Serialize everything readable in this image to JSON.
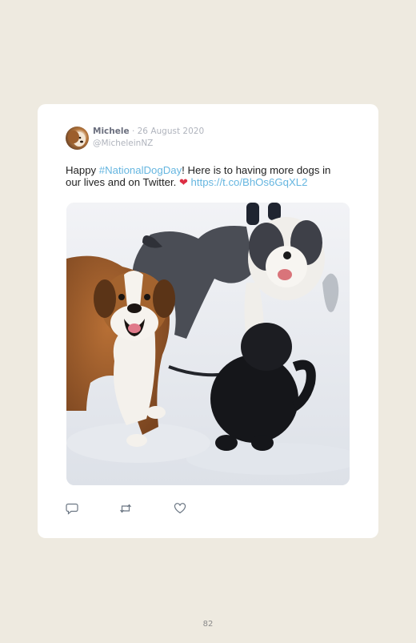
{
  "tweet": {
    "author_name": "Michele",
    "separator": "·",
    "date": "26 August 2020",
    "handle": "@MicheleinNZ",
    "text_before_hashtag": "Happy ",
    "hashtag": "#NationalDogDay",
    "text_after_hashtag": "! Here is to having more dogs in our lives and on Twitter. ",
    "heart_emoji": "❤",
    "link": "https://t.co/BhOs6GqXL2",
    "link_color": "#66b6e0",
    "heart_color": "#dd2e44",
    "photo_description_icon": "photo-three-dogs-in-snow"
  },
  "actions": {
    "reply_icon": "reply-icon",
    "retweet_icon": "retweet-icon",
    "like_icon": "heart-icon"
  },
  "page": {
    "number": "82",
    "background": "#eeeae0",
    "card_background": "#ffffff"
  }
}
